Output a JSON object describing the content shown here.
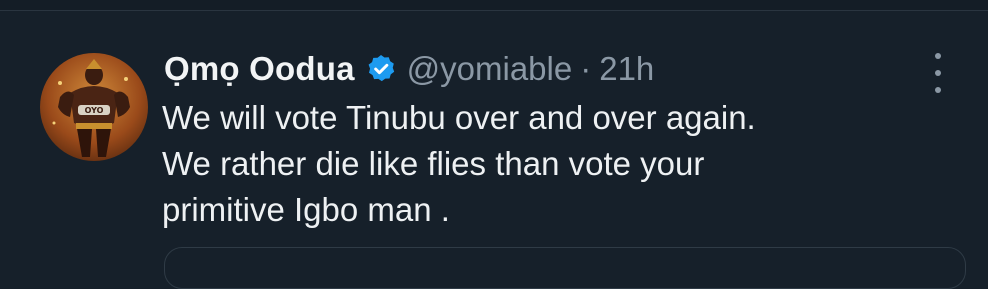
{
  "tweet": {
    "author": {
      "display_name": "Ọmọ Oodua",
      "handle": "@yomiable",
      "avatar_icon": "warrior-avatar",
      "verified_icon": "verified-badge-icon"
    },
    "separator": "·",
    "timestamp": "21h",
    "text": "We will vote Tinubu over and over again.\nWe rather die like flies than vote your\nprimitive Igbo man .",
    "more_icon": "more-options-icon"
  },
  "colors": {
    "background": "#16202a",
    "text_primary": "#eef1f3",
    "text_secondary": "#8b98a5",
    "verified_blue": "#1d9bf0"
  }
}
